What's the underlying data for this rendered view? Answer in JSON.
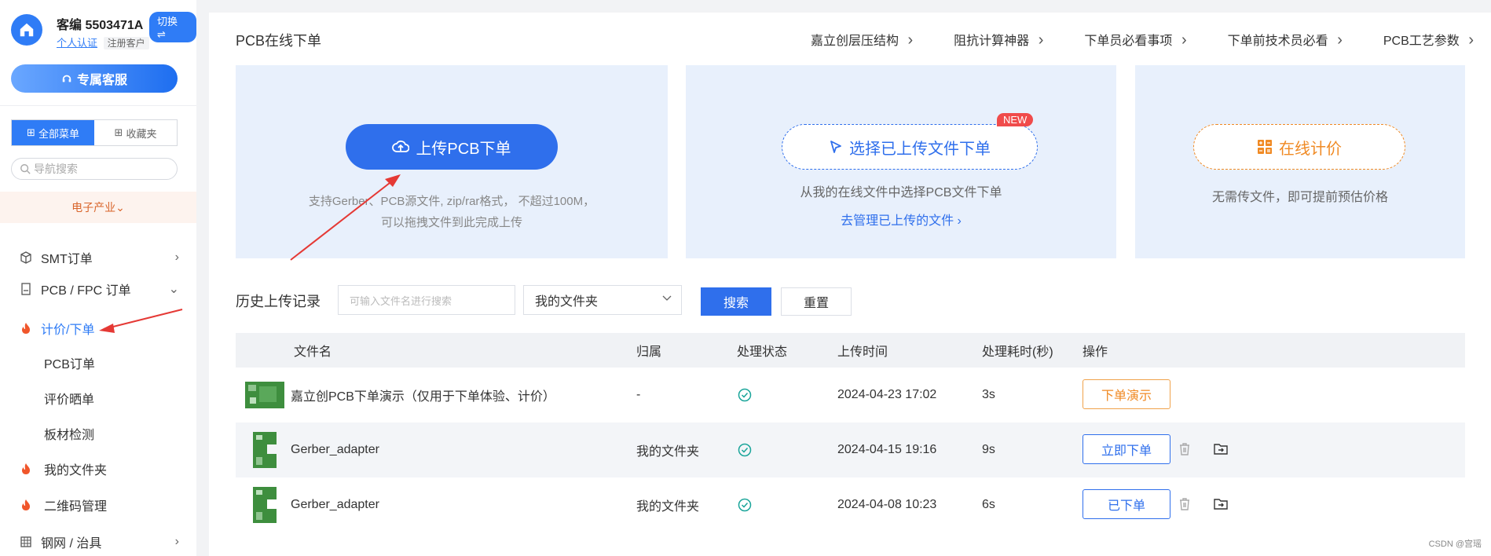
{
  "user": {
    "name": "客编 5503471A",
    "switch_label": "切换 ⇌",
    "auth_link": "个人认证",
    "register_badge": "注册客户"
  },
  "service_button": "专属客服",
  "menu_tabs": [
    {
      "label": "全部菜单"
    },
    {
      "label": "收藏夹"
    }
  ],
  "nav_search": {
    "placeholder": "导航搜索"
  },
  "industry": "电子产业⌄",
  "nav": [
    {
      "label": "SMT订单",
      "chevron": "›"
    },
    {
      "label": "PCB / FPC 订单",
      "chevron": "⌄"
    },
    {
      "label": "计价/下单"
    },
    {
      "label": "PCB订单"
    },
    {
      "label": "评价晒单"
    },
    {
      "label": "板材检测"
    },
    {
      "label": "我的文件夹"
    },
    {
      "label": "二维码管理"
    },
    {
      "label": "钢网 / 治具",
      "chevron": "›"
    }
  ],
  "page": {
    "title": "PCB在线下单",
    "top_links": [
      "嘉立创层压结构",
      "阻抗计算神器",
      "下单员必看事项",
      "下单前技术员必看",
      "PCB工艺参数"
    ]
  },
  "cards": {
    "upload": {
      "button": "上传PCB下单",
      "desc_line1": "支持Gerber、PCB源文件, zip/rar格式， 不超过100M，",
      "desc_line2": "可以拖拽文件到此完成上传"
    },
    "select": {
      "button": "选择已上传文件下单",
      "badge": "NEW",
      "desc": "从我的在线文件中选择PCB文件下单",
      "manage_link": "去管理已上传的文件  ›"
    },
    "price": {
      "button": "在线计价",
      "desc": "无需传文件，即可提前预估价格"
    }
  },
  "history": {
    "label": "历史上传记录",
    "search_placeholder": "可输入文件名进行搜索",
    "folder_select": "我的文件夹",
    "search_button": "搜索",
    "reset_button": "重置"
  },
  "table": {
    "headers": [
      "文件名",
      "归属",
      "处理状态",
      "上传时间",
      "处理耗时(秒)",
      "操作"
    ],
    "rows": [
      {
        "file": "嘉立创PCB下单演示（仅用于下单体验、计价）",
        "owner": "-",
        "time": "2024-04-23 17:02",
        "duration": "3s",
        "action": "下单演示"
      },
      {
        "file": "Gerber_adapter",
        "owner": "我的文件夹",
        "time": "2024-04-15 19:16",
        "duration": "9s",
        "action": "立即下单"
      },
      {
        "file": "Gerber_adapter",
        "owner": "我的文件夹",
        "time": "2024-04-08 10:23",
        "duration": "6s",
        "action": "已下单"
      }
    ]
  },
  "watermark": "CSDN @宫瑶",
  "colors": {
    "primary": "#2f6fec",
    "accent_orange": "#f08a24",
    "badge_red": "#f04b4b",
    "annotation_red": "#e53935"
  }
}
